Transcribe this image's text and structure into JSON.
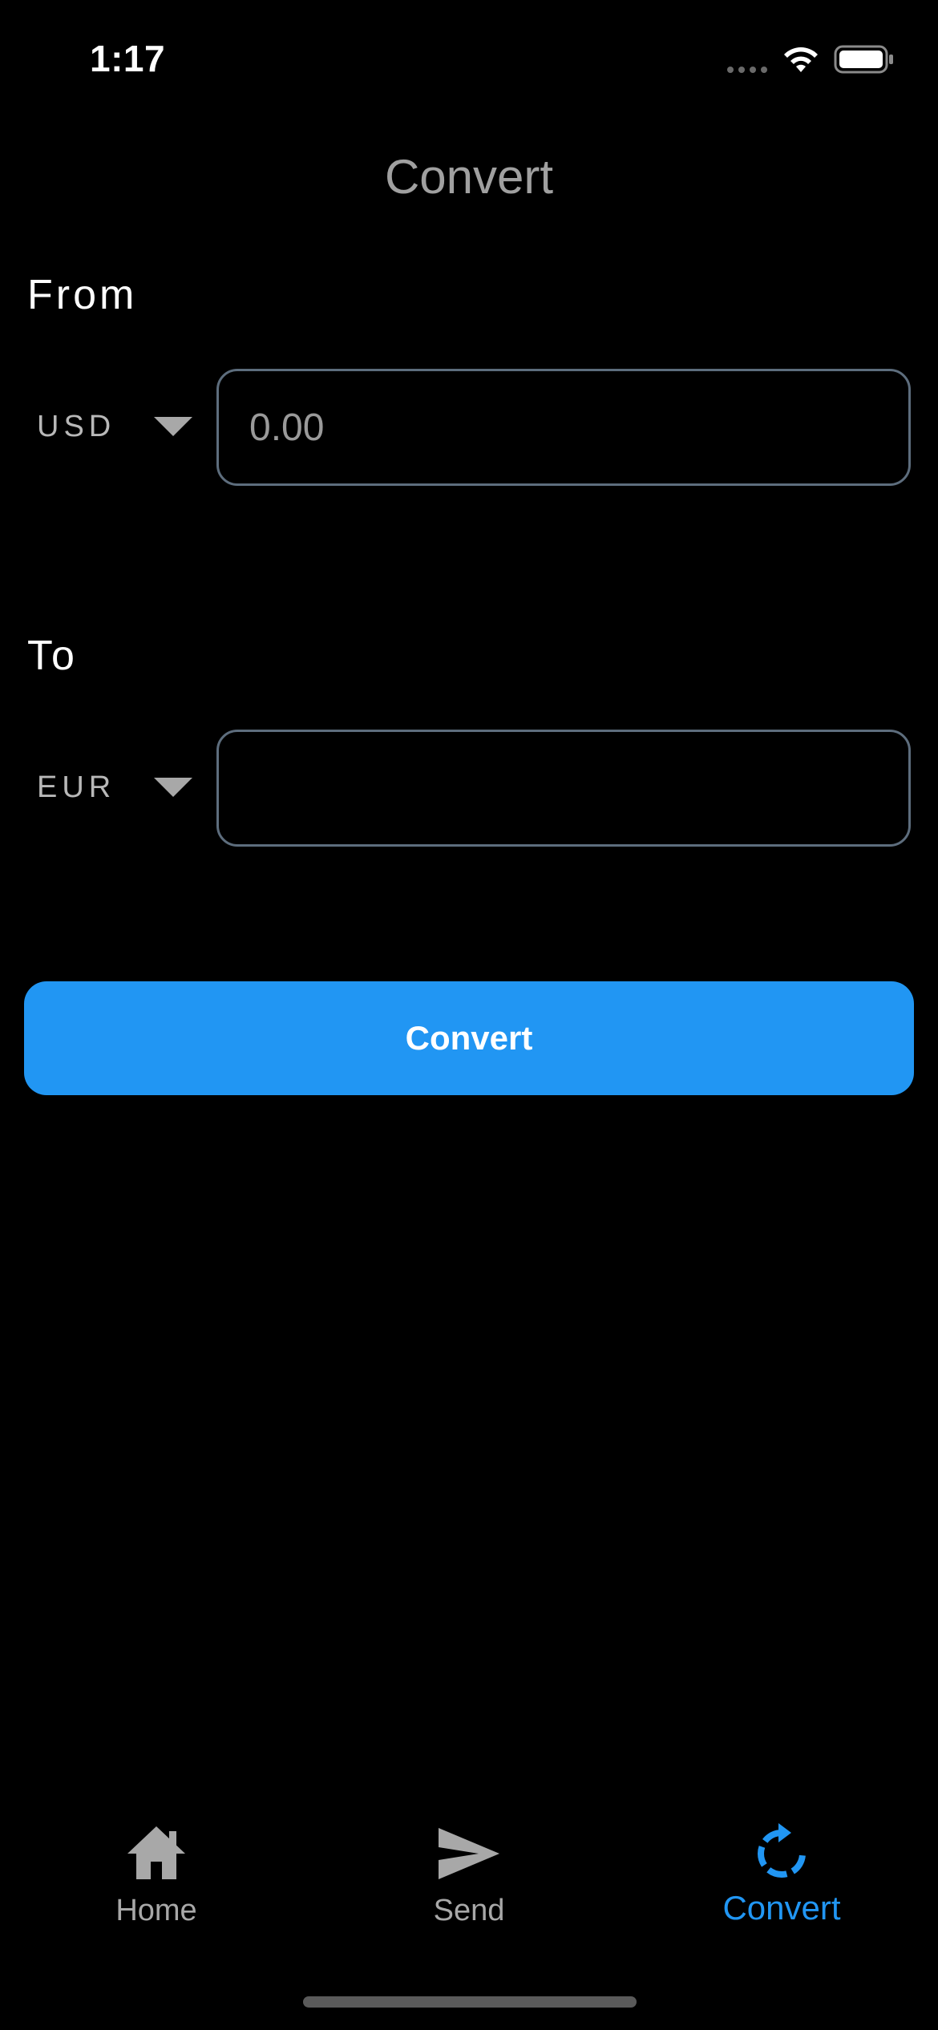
{
  "status_bar": {
    "time": "1:17"
  },
  "header": {
    "title": "Convert"
  },
  "from": {
    "label": "From",
    "currency": "USD",
    "amount_value": "",
    "amount_placeholder": "0.00"
  },
  "to": {
    "label": "To",
    "currency": "EUR",
    "amount_value": "",
    "amount_placeholder": ""
  },
  "convert_button": {
    "label": "Convert"
  },
  "tab_bar": {
    "active": "Convert",
    "tabs": [
      {
        "label": "Home",
        "icon": "home-icon"
      },
      {
        "label": "Send",
        "icon": "send-icon"
      },
      {
        "label": "Convert",
        "icon": "refresh-icon"
      }
    ]
  },
  "colors": {
    "accent": "#2196f3",
    "background": "#000000",
    "field_border": "#5d6d7d",
    "inactive_tab": "#a8a8a8"
  }
}
